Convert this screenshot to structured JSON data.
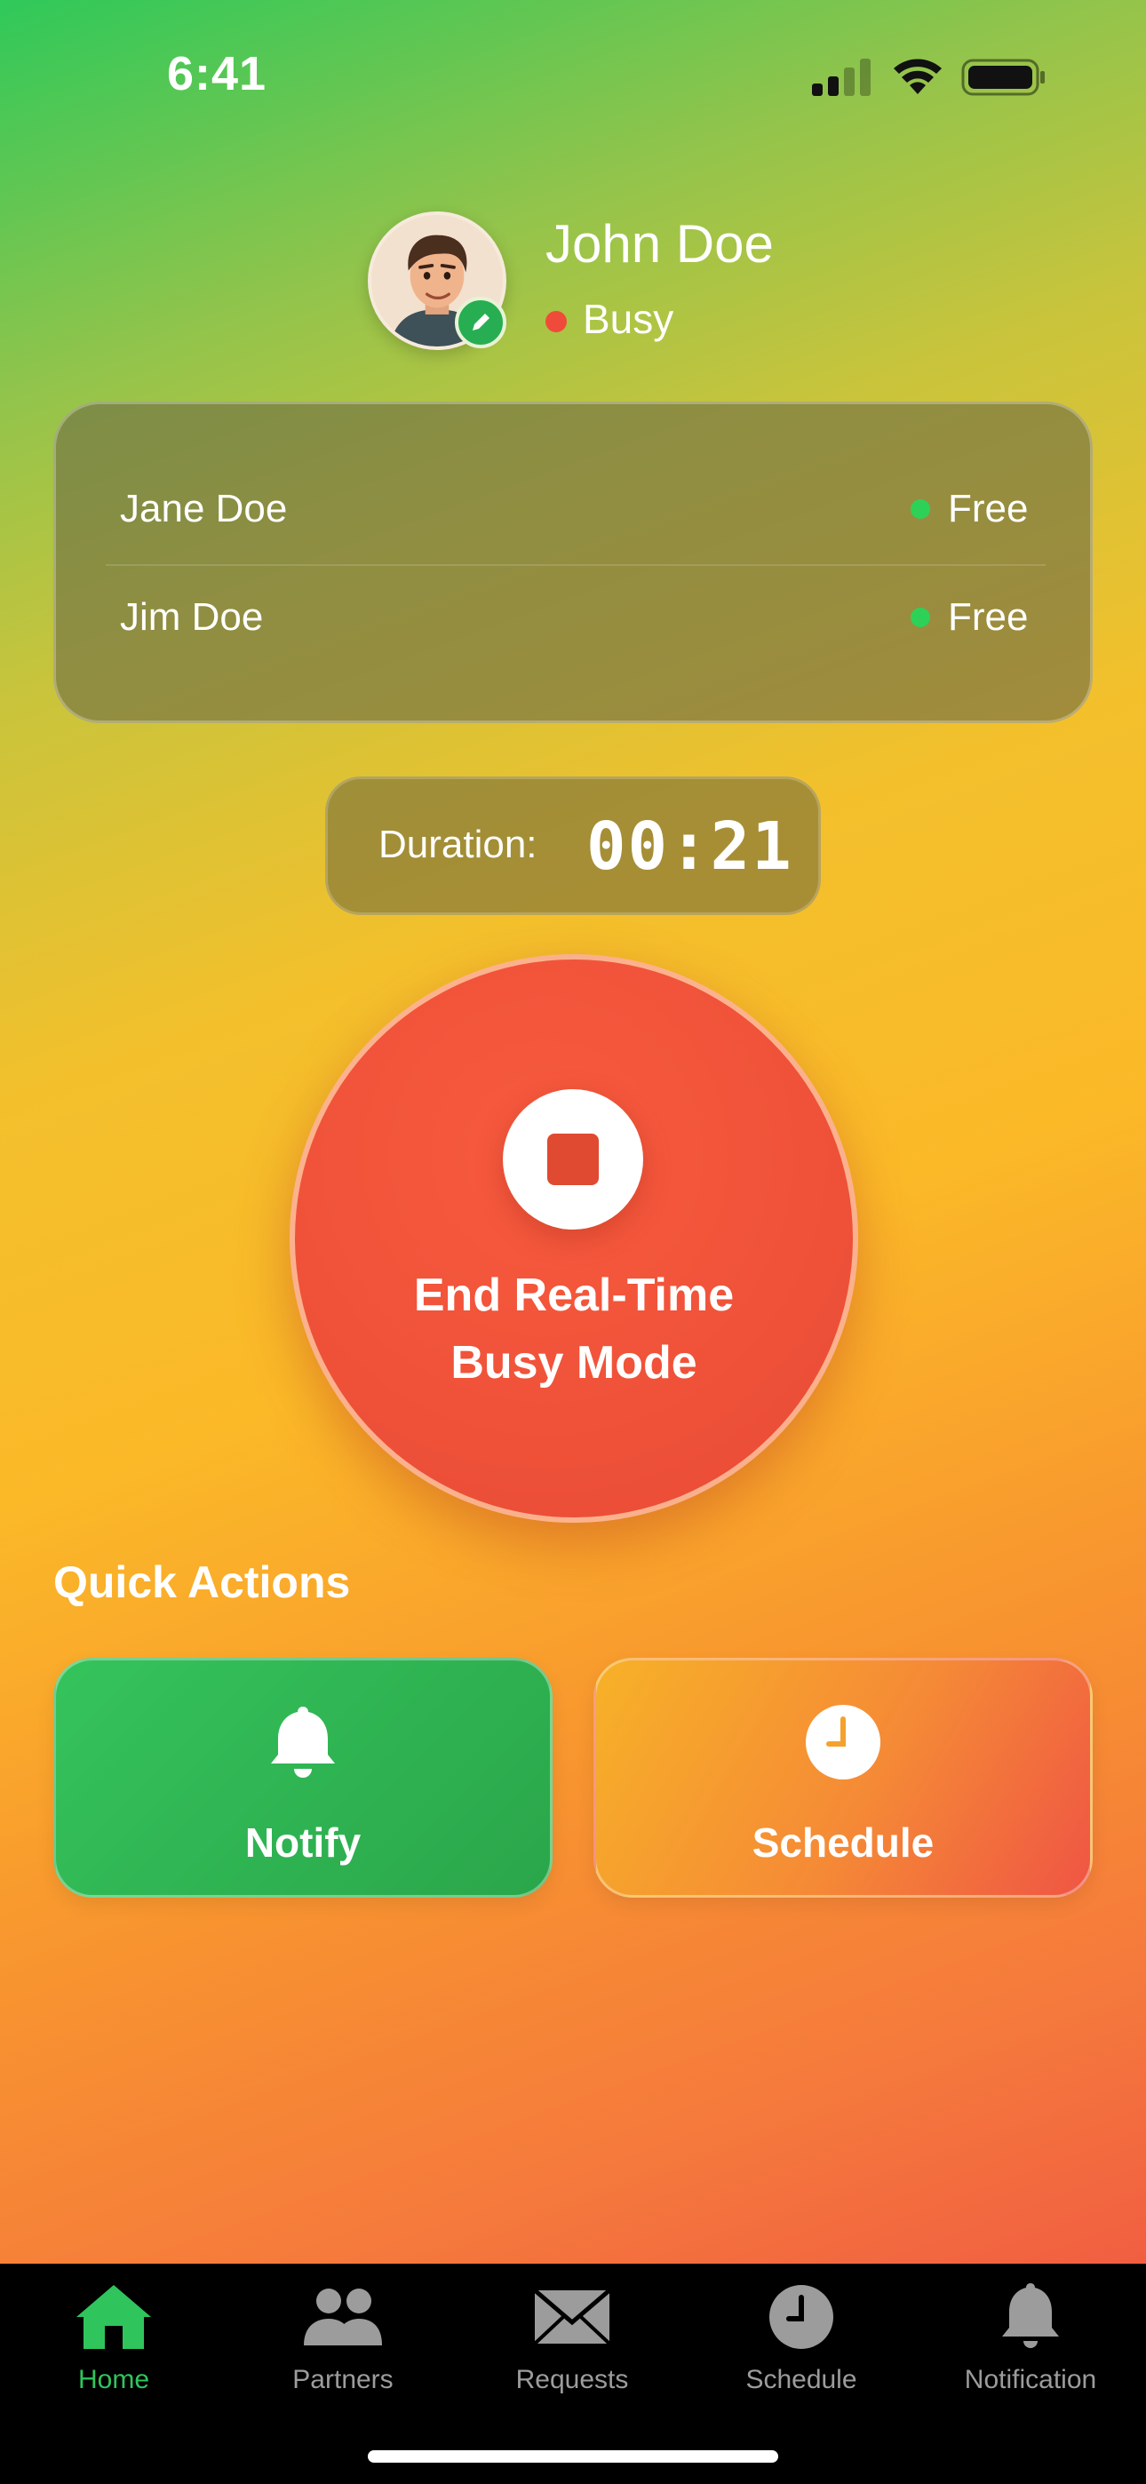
{
  "status_bar": {
    "time": "6:41"
  },
  "profile": {
    "name": "John Doe",
    "status": "Busy",
    "status_color": "#f04a3a"
  },
  "partners": [
    {
      "name": "Jane Doe",
      "status": "Free"
    },
    {
      "name": "Jim Doe",
      "status": "Free"
    }
  ],
  "duration": {
    "label": "Duration:",
    "value": "00:21"
  },
  "end_button": {
    "line1": "End Real-Time",
    "line2": "Busy Mode"
  },
  "quick_actions": {
    "title": "Quick Actions",
    "notify_label": "Notify",
    "schedule_label": "Schedule"
  },
  "tabs": [
    {
      "label": "Home",
      "icon": "home-icon",
      "active": true
    },
    {
      "label": "Partners",
      "icon": "people-icon",
      "active": false
    },
    {
      "label": "Requests",
      "icon": "envelope-icon",
      "active": false
    },
    {
      "label": "Schedule",
      "icon": "clock-icon",
      "active": false
    },
    {
      "label": "Notification",
      "icon": "bell-icon",
      "active": false
    }
  ],
  "colors": {
    "accent_green": "#30c45c",
    "danger_red": "#f05339",
    "free_green": "#2ed158"
  }
}
